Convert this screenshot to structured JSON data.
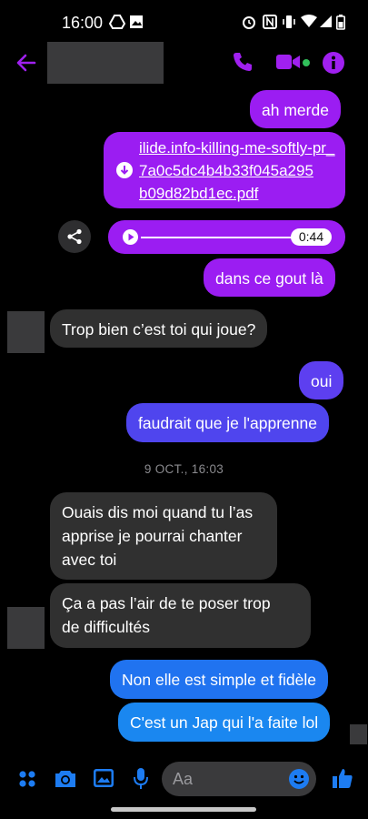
{
  "status_bar": {
    "time": "16:00"
  },
  "header": {
    "contact_name": ""
  },
  "messages": {
    "m1": "ah merde",
    "file_lines": [
      "ilide.info-killing-me-softly-pr_",
      "7a0c5dc4b4b33f045a295",
      "b09d82bd1ec.pdf"
    ],
    "audio_duration": "0:44",
    "m3": "dans ce gout là",
    "m4": "Trop bien c’est toi qui joue?",
    "m5": "oui",
    "m6": "faudrait que je l'apprenne",
    "timestamp": "9 OCT., 16:03",
    "m7_lines": [
      "Ouais dis moi quand tu l’as",
      "apprise je pourrai chanter",
      "avec toi"
    ],
    "m8_lines": [
      "Ça a pas l’air de te poser trop",
      "de difficultés"
    ],
    "m9": "Non elle est simple et fidèle",
    "m10": "C'est un Jap qui l'a faite lol"
  },
  "composer": {
    "placeholder": "Aa"
  },
  "colors": {
    "accent": "#a020f0",
    "bubble_purple": "#9b1df2",
    "bubble_violet": "#6f3bf0",
    "bubble_blue": "#1d7cf2",
    "bubble_gray": "#303030",
    "online_dot": "#31c05a"
  }
}
